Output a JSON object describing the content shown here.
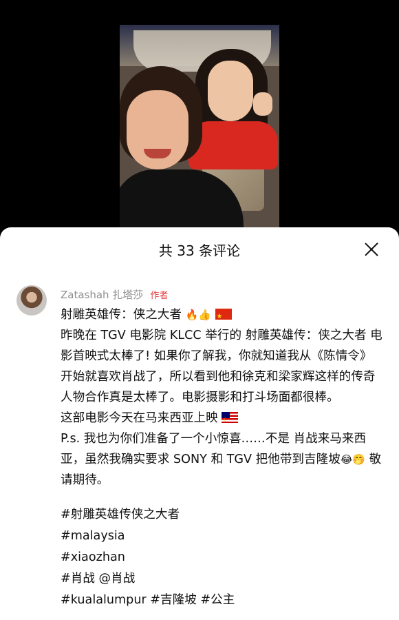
{
  "comments_sheet": {
    "title": "共 33 条评论"
  },
  "comment": {
    "username": "Zatashah 扎塔莎",
    "author_tag": "作者",
    "line1": "射雕英雄传：侠之大者",
    "line1_emoji": "🔥👍",
    "paragraph1": "昨晚在 TGV 电影院 KLCC 举行的 射雕英雄传：侠之大者 电影首映式太棒了! 如果你了解我，你就知道我从《陈情令》开始就喜欢肖战了，所以看到他和徐克和梁家辉这样的传奇人物合作真是太棒了。电影摄影和打斗场面都很棒。",
    "line_release": "这部电影今天在马来西亚上映",
    "paragraph_ps": "P.s. 我也为你们准备了一个小惊喜……不是 肖战来马来西亚，虽然我确实要求 SONY 和 TGV 把他带到吉隆坡",
    "ps_emoji": "😂🤭",
    "ps_end": " 敬请期待。"
  },
  "hashtags": {
    "tag1": "#射雕英雄传侠之大者",
    "tag2": "#malaysia",
    "tag3": "#xiaozhan",
    "tag4": "#肖战 @肖战",
    "tag5": "#kualalumpur #吉隆坡 #公主"
  }
}
